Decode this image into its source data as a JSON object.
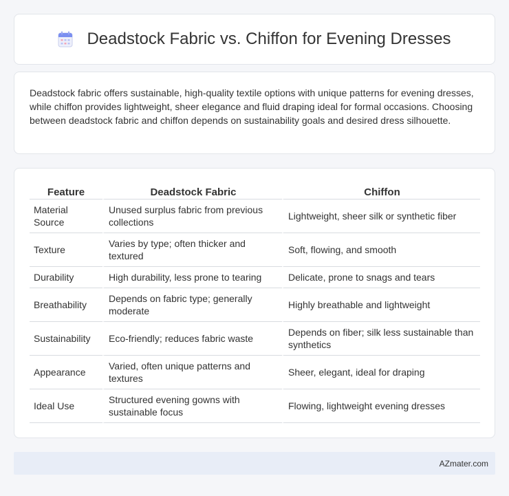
{
  "header": {
    "title": "Deadstock Fabric vs. Chiffon for Evening Dresses",
    "icon": "calendar-icon"
  },
  "intro": {
    "text": "Deadstock fabric offers sustainable, high-quality textile options with unique patterns for evening dresses, while chiffon provides lightweight, sheer elegance and fluid draping ideal for formal occasions. Choosing between deadstock fabric and chiffon depends on sustainability goals and desired dress silhouette."
  },
  "table": {
    "headers": [
      "Feature",
      "Deadstock Fabric",
      "Chiffon"
    ],
    "rows": [
      [
        "Material Source",
        "Unused surplus fabric from previous collections",
        "Lightweight, sheer silk or synthetic fiber"
      ],
      [
        "Texture",
        "Varies by type; often thicker and textured",
        "Soft, flowing, and smooth"
      ],
      [
        "Durability",
        "High durability, less prone to tearing",
        "Delicate, prone to snags and tears"
      ],
      [
        "Breathability",
        "Depends on fabric type; generally moderate",
        "Highly breathable and lightweight"
      ],
      [
        "Sustainability",
        "Eco-friendly; reduces fabric waste",
        "Depends on fiber; silk less sustainable than synthetics"
      ],
      [
        "Appearance",
        "Varied, often unique patterns and textures",
        "Sheer, elegant, ideal for draping"
      ],
      [
        "Ideal Use",
        "Structured evening gowns with sustainable focus",
        "Flowing, lightweight evening dresses"
      ]
    ]
  },
  "footer": {
    "brand": "AZmater.com"
  },
  "colors": {
    "page_bg": "#f5f6f9",
    "card_bg": "#ffffff",
    "footer_bg": "#e8edf7",
    "icon_accent": "#7b8ff0"
  }
}
